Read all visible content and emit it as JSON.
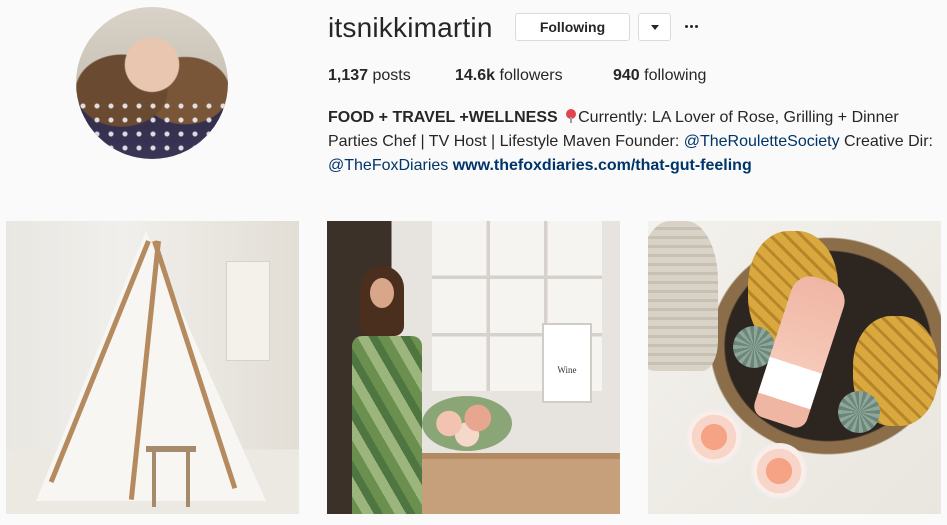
{
  "profile": {
    "username": "itsnikkimartin",
    "following_button": "Following",
    "more_icon": "ellipsis-icon",
    "dropdown_icon": "chevron-down-icon"
  },
  "stats": {
    "posts_count": "1,137",
    "posts_label": " posts",
    "followers_count": "14.6k",
    "followers_label": " followers",
    "following_count": "940",
    "following_label": " following"
  },
  "bio": {
    "name": "FOOD + TRAVEL +WELLNESS",
    "text_1": "Currently: LA Lover of Rose, Grilling + Dinner Parties Chef | TV Host | Lifestyle Maven Founder: ",
    "mention_1": "@TheRouletteSociety",
    "text_2": " Creative Dir: ",
    "mention_2": "@TheFoxDiaries",
    "text_3": " ",
    "url": "www.thefoxdiaries.com/that-gut-feeling"
  },
  "posts": [
    {
      "kind": "photo"
    },
    {
      "kind": "photo",
      "sign_text": "Wine"
    },
    {
      "kind": "photo"
    }
  ],
  "colors": {
    "background": "#fafafa",
    "text": "#262626",
    "link": "#003569",
    "border": "#dbdbdb"
  }
}
